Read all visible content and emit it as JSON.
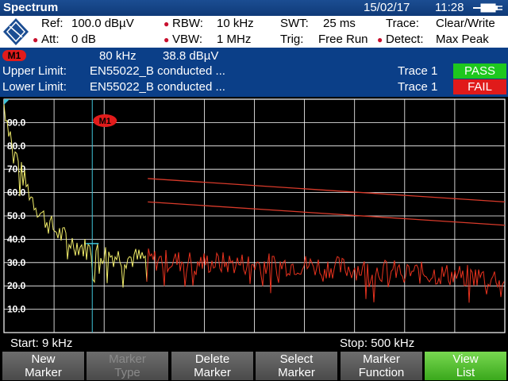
{
  "window": {
    "mode_title": "Spectrum",
    "date": "15/02/17",
    "time": "11:28"
  },
  "params": {
    "ref_label": "Ref:",
    "ref_value": "100.0 dBµV",
    "att_label": "Att:",
    "att_value": "0 dB",
    "rbw_label": "RBW:",
    "rbw_value": "10 kHz",
    "vbw_label": "VBW:",
    "vbw_value": "1 MHz",
    "swt_label": "SWT:",
    "swt_value": "25 ms",
    "trig_label": "Trig:",
    "trig_value": "Free Run",
    "trace_label": "Trace:",
    "trace_value": "Clear/Write",
    "detect_label": "Detect:",
    "detect_value": "Max Peak"
  },
  "marker": {
    "badge": "M1",
    "freq": "80  kHz",
    "level": "38.8  dBµV"
  },
  "limits": {
    "upper_label": "Upper Limit:",
    "upper_value": "EN55022_B conducted ...",
    "upper_trace": "Trace 1",
    "upper_status": "PASS",
    "lower_label": "Lower Limit:",
    "lower_value": "EN55022_B conducted ...",
    "lower_trace": "Trace 1",
    "lower_status": "FAIL"
  },
  "axis": {
    "start": "Start:  9 kHz",
    "stop": "Stop: 500 kHz"
  },
  "softkeys": [
    {
      "line1": "New",
      "line2": "Marker"
    },
    {
      "line1": "Marker",
      "line2": "Type"
    },
    {
      "line1": "Delete",
      "line2": "Marker"
    },
    {
      "line1": "Select",
      "line2": "Marker"
    },
    {
      "line1": "Marker",
      "line2": "Function"
    },
    {
      "line1": "View",
      "line2": "List"
    }
  ],
  "colors": {
    "trace_pass": "#f2ee6a",
    "trace_fail": "#e8321e",
    "limit_line": "#d83a2a",
    "marker_line": "#3fc3d8"
  },
  "chart_data": {
    "type": "line",
    "y_tick_labels": [
      "90.0",
      "80.0",
      "70.0",
      "60.0",
      "50.0",
      "40.0",
      "30.0",
      "20.0",
      "10.0"
    ],
    "ylim": [
      0,
      100
    ],
    "grid": true,
    "marker_label": "M1",
    "marker_point": {
      "x": 80,
      "y": 38.8
    }
  }
}
